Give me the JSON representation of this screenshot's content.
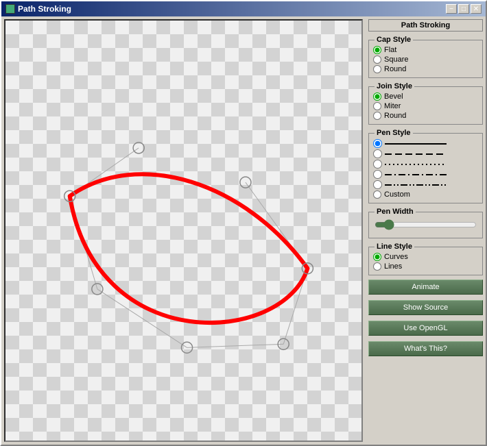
{
  "window": {
    "title": "Path Stroking",
    "icon": "path-icon"
  },
  "titleButtons": {
    "minimize": "−",
    "maximize": "□",
    "close": "✕"
  },
  "rightPanel": {
    "pathStrokingLabel": "Path Stroking",
    "capStyle": {
      "label": "Cap Style",
      "options": [
        "Flat",
        "Square",
        "Round"
      ],
      "selected": 0
    },
    "joinStyle": {
      "label": "Join Style",
      "options": [
        "Bevel",
        "Miter",
        "Round"
      ],
      "selected": 0
    },
    "penStyle": {
      "label": "Pen Style",
      "options": [
        "solid",
        "dash",
        "dot",
        "dashdot",
        "dashdotdot",
        "Custom"
      ],
      "selected": 0
    },
    "penWidth": {
      "label": "Pen Width",
      "value": 2,
      "min": 0,
      "max": 20
    },
    "lineStyle": {
      "label": "Line Style",
      "options": [
        "Curves",
        "Lines"
      ],
      "selected": 0
    },
    "buttons": {
      "animate": "Animate",
      "showSource": "Show Source",
      "useOpenGL": "Use OpenGL",
      "whatsThis": "What's This?"
    }
  }
}
